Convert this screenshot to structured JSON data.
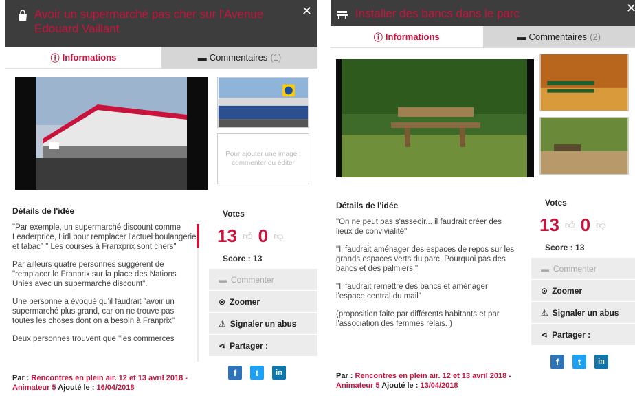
{
  "panel1": {
    "title": "Avoir un supermarché pas cher sur l'Avenue Edouard Vaillant",
    "tab_info": "Informations",
    "tab_comments": "Commentaires",
    "comments_count": "(1)",
    "placeholder_text": "Pour ajouter une image : commenter ou éditer",
    "details_title": "Détails de l'idée",
    "paragraphs": [
      "\"Par exemple, un supermarché discount comme Leaderprice, Lidl pour remplacer l'actuel boulangerie et tabac\" \" Les courses à Franxprix sont chers\"",
      "Par ailleurs quatre personnes suggèrent de \"remplacer le Franprix sur la place des Nations Unies avec un supermarché discount\".",
      "Une personne a évoqué qu'il faudrait \"avoir un supermarché plus grand, car on ne trouve pas toutes les choses dont on a besoin à Franprix\"",
      "Deux personnes trouvent que \"les commerces"
    ],
    "author_prefix": "Par : ",
    "author_name": "Rencontres en plein air. 12 et 13 avril 2018 - Animateur 5",
    "added_label": " Ajouté le : ",
    "added_date": "16/04/2018",
    "votes_title": "Votes",
    "votes_up": "13",
    "votes_down": "0",
    "score": "Score : 13",
    "action_comment": "Commenter",
    "action_zoom": "Zoomer",
    "action_report": "Signaler un abus",
    "action_share": "Partager :"
  },
  "panel2": {
    "title": "Installer des bancs dans le parc",
    "tab_info": "Informations",
    "tab_comments": "Commentaires",
    "comments_count": "(2)",
    "details_title": "Détails de l'idée",
    "paragraphs": [
      "\"On ne peut pas s'asseoir... il faudrait créer des lieux de convivialité\"",
      "\"Il faudrait aménager des espaces de repos sur les grands espaces verts du parc. Pourquoi pas des bancs et des palmiers.\"",
      "\"Il faudrait remettre des bancs et aménager l'espace central du mail\"",
      "(proposition faite par différents habitants et par l'association des femmes relais. )"
    ],
    "author_prefix": "Par : ",
    "author_name": "Rencontres en plein air. 12 et 13 avril 2018 - Animateur 5",
    "added_label": " Ajouté le : ",
    "added_date": "13/04/2018",
    "votes_title": "Votes",
    "votes_up": "13",
    "votes_down": "0",
    "score": "Score : 13",
    "action_comment": "Commenter",
    "action_zoom": "Zoomer",
    "action_report": "Signaler un abus",
    "action_share": "Partager :"
  },
  "colors": {
    "accent": "#c8143d",
    "header_bg": "#3d3d3d",
    "facebook": "#2e73b8",
    "twitter": "#1da1f2",
    "linkedin": "#0e76a8"
  },
  "icons": [
    "shopping-bag-icon",
    "bench-icon",
    "close-icon",
    "info-icon",
    "comment-icon",
    "thumbs-up-icon",
    "thumbs-down-icon",
    "zoom-icon",
    "warning-icon",
    "share-icon",
    "facebook-icon",
    "twitter-icon",
    "linkedin-icon"
  ]
}
